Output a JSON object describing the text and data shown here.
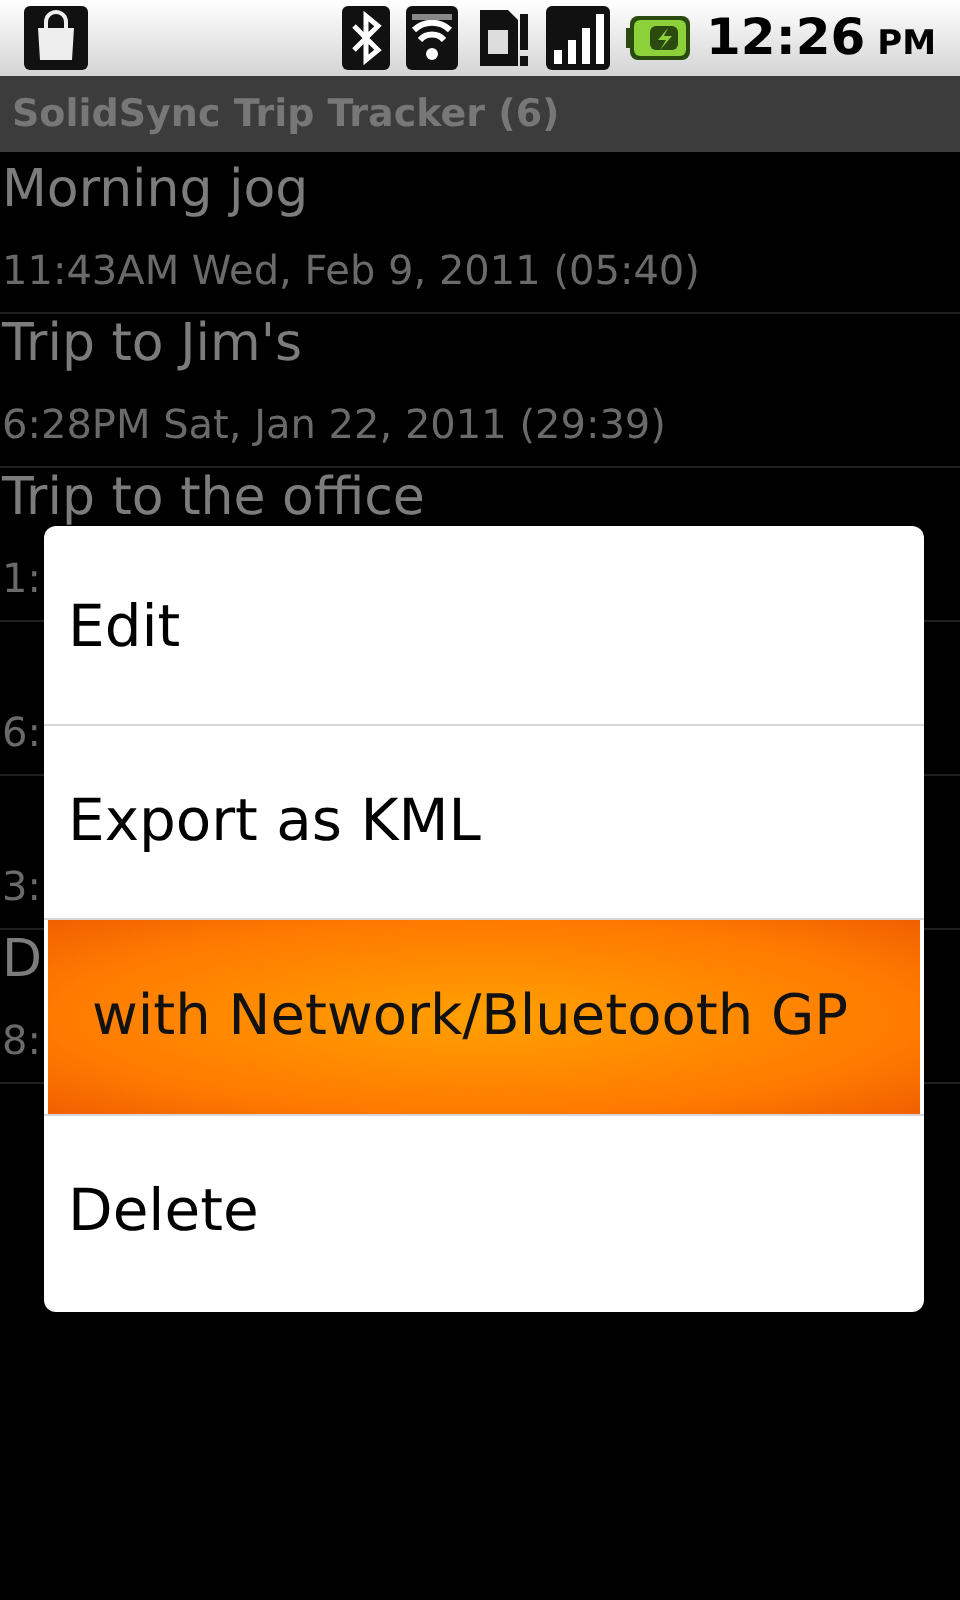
{
  "status_bar": {
    "time": "12:26",
    "meridiem": "PM"
  },
  "title_bar": {
    "title": "SolidSync Trip Tracker (6)"
  },
  "trips": [
    {
      "title": "Morning jog",
      "subtitle": "11:43AM Wed, Feb 9, 2011 (05:40)"
    },
    {
      "title": "Trip to Jim's",
      "subtitle": "6:28PM Sat, Jan 22, 2011 (29:39)"
    },
    {
      "title": "Trip to the office",
      "subtitle": "1:"
    },
    {
      "subtitle": "6:"
    },
    {
      "subtitle": "3:"
    },
    {
      "title": "D",
      "subtitle": "8:"
    }
  ],
  "context_menu": {
    "items": [
      {
        "label": "Edit",
        "selected": false
      },
      {
        "label": "Export as KML",
        "selected": false
      },
      {
        "label": "with Network/Bluetooth GP",
        "selected": true
      },
      {
        "label": "Delete",
        "selected": false
      }
    ]
  }
}
